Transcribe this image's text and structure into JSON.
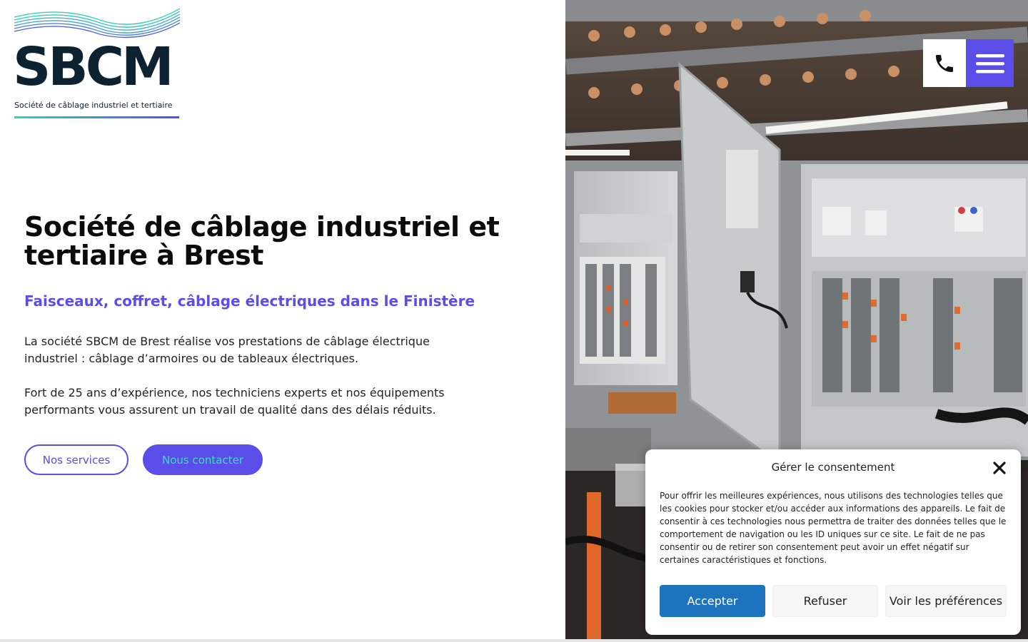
{
  "logo": {
    "wordmark": "SBCM",
    "tagline": "Société de câblage industriel et tertiaire"
  },
  "hero": {
    "title": "Société de câblage industriel et tertiaire à Brest",
    "subtitle": "Faisceaux, coffret, câblage électriques dans le Finistère",
    "paragraph1": "La société SBCM de Brest réalise vos prestations de câblage électrique industriel : câblage d’armoires ou de tableaux électriques.",
    "paragraph2": "Fort de 25 ans d’expérience, nos techniciens experts et nos équipements performants vous assurent un travail de qualité dans des délais réduits.",
    "btn_services": "Nos services",
    "btn_contact": "Nous contacter"
  },
  "header_actions": {
    "phone_icon": "phone-icon",
    "menu_icon": "hamburger-menu-icon"
  },
  "consent": {
    "title": "Gérer le consentement",
    "text": "Pour offrir les meilleures expériences, nous utilisons des technologies telles que les cookies pour stocker et/ou accéder aux informations des appareils. Le fait de consentir à ces technologies nous permettra de traiter des données telles que le comportement de navigation ou les ID uniques sur ce site. Le fait de ne pas consentir ou de retirer son consentement peut avoir un effet négatif sur certaines caractéristiques et fonctions.",
    "accept": "Accepter",
    "refuse": "Refuser",
    "preferences": "Voir les préférences"
  },
  "colors": {
    "accent": "#5a4de8",
    "teal": "#36e0c3",
    "navy": "#0d2230",
    "accept_blue": "#1e73be"
  }
}
